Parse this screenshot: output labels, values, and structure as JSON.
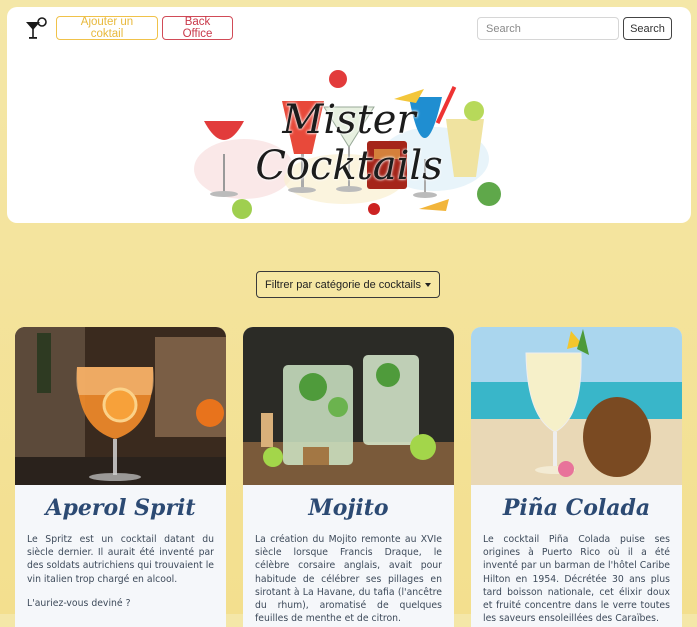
{
  "header": {
    "add_cocktail_label": "Ajouter un coktail",
    "back_office_label": "Back Office",
    "search_placeholder": "Search",
    "search_button_label": "Search",
    "brand_title": "Mister Cocktails"
  },
  "filter": {
    "label": "Filtrer par catégorie de cocktails"
  },
  "cards": [
    {
      "title": "Aperol Sprit",
      "p1": "Le Spritz est un cocktail datant du siècle dernier. Il aurait été inventé par des soldats autrichiens qui trouvaient le vin italien trop chargé en alcool.",
      "p2": "L'auriez-vous deviné ?"
    },
    {
      "title": "Mojito",
      "p1": "La création du Mojito remonte au XVIe siècle lorsque Francis Draque, le célèbre corsaire anglais, avait pour habitude de célébrer ses pillages en sirotant à La Havane, du tafia (l'ancêtre du rhum), aromatisé de quelques feuilles de menthe et de citron."
    },
    {
      "title": "Piña Colada",
      "p1": "Le cocktail Piña Colada puise ses origines à Puerto Rico où il a été inventé par un barman de l'hôtel Caribe Hilton en 1954. Décrétée 30 ans plus tard boisson nationale, cet élixir doux et fruité concentre dans le verre toutes les saveurs ensoleillées des Caraïbes."
    }
  ],
  "colors": {
    "accent_yellow": "#f0c24a",
    "back_office_red": "#c9394a",
    "card_title_blue": "#2c4a73",
    "page_background": "#f3e39c"
  },
  "icons": {
    "logo": "cocktail-glass-icon",
    "filter_caret": "caret-down-icon"
  }
}
